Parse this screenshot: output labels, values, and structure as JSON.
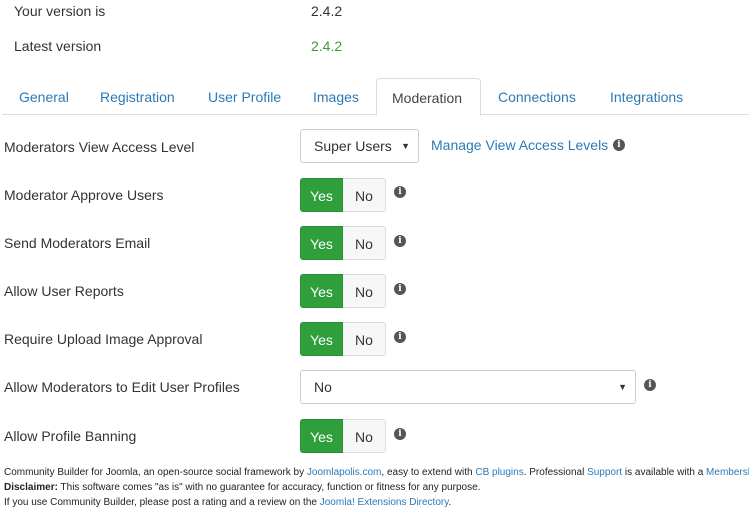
{
  "version": {
    "your_label": "Your version is",
    "your_value": "2.4.2",
    "latest_label": "Latest version",
    "latest_value": "2.4.2",
    "latest_color": "#3c9b3c"
  },
  "tabs": [
    {
      "label": "General"
    },
    {
      "label": "Registration"
    },
    {
      "label": "User Profile"
    },
    {
      "label": "Images"
    },
    {
      "label": "Moderation"
    },
    {
      "label": "Connections"
    },
    {
      "label": "Integrations"
    }
  ],
  "active_tab": "Moderation",
  "fields": {
    "view_access": {
      "label": "Moderators View Access Level",
      "value": "Super Users",
      "link": "Manage View Access Levels"
    },
    "approve_users": {
      "label": "Moderator Approve Users",
      "yes": "Yes",
      "no": "No",
      "selected": "Yes"
    },
    "send_email": {
      "label": "Send Moderators Email",
      "yes": "Yes",
      "no": "No",
      "selected": "Yes"
    },
    "user_reports": {
      "label": "Allow User Reports",
      "yes": "Yes",
      "no": "No",
      "selected": "Yes"
    },
    "image_approval": {
      "label": "Require Upload Image Approval",
      "yes": "Yes",
      "no": "No",
      "selected": "Yes"
    },
    "edit_profiles": {
      "label": "Allow Moderators to Edit User Profiles",
      "value": "No"
    },
    "profile_banning": {
      "label": "Allow Profile Banning",
      "yes": "Yes",
      "no": "No",
      "selected": "Yes"
    }
  },
  "footer": {
    "line1_a": "Community Builder for Joomla, an open-source social framework by ",
    "line1_link1": "Joomlapolis.com",
    "line1_b": ", easy to extend with ",
    "line1_link2": "CB plugins",
    "line1_c": ". Professional ",
    "line1_link3": "Support",
    "line1_d": " is available with a ",
    "line1_link4": "Membership",
    "line1_e": ".",
    "disclaimer_label": "Disclaimer:",
    "disclaimer_text": " This software comes \"as is\" with no guarantee for accuracy, function or fitness for any purpose.",
    "line3_a": "If you use Community Builder, please post a rating and a review on the ",
    "line3_link": "Joomla! Extensions Directory",
    "line3_b": "."
  },
  "colors": {
    "accent": "#2a7ab8",
    "toggle_on": "#2f9f3c"
  },
  "icons": {
    "info": "info-circle-icon",
    "caret": "caret-down-icon"
  }
}
